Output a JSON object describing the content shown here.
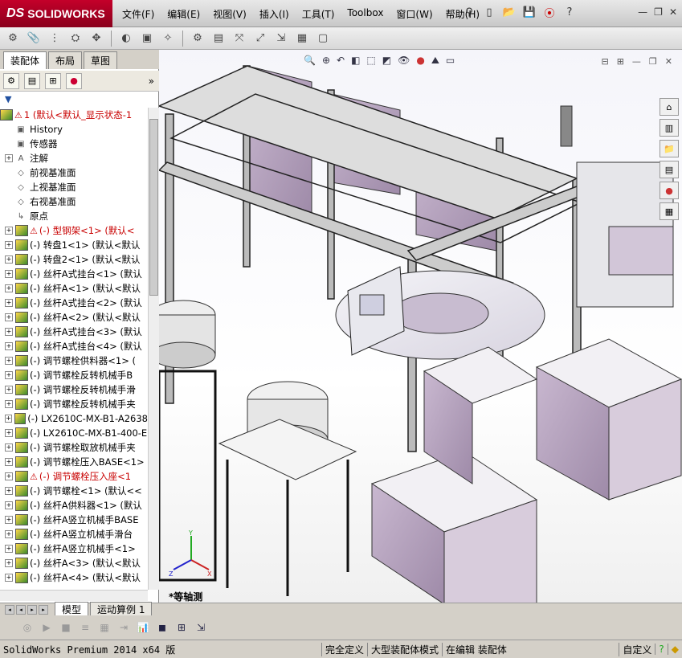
{
  "app": {
    "brand": "SOLIDWORKS",
    "brand_prefix": "DS"
  },
  "menu": [
    "文件(F)",
    "编辑(E)",
    "视图(V)",
    "插入(I)",
    "工具(T)",
    "Toolbox",
    "窗口(W)",
    "帮助(H)"
  ],
  "panel_tabs": [
    "装配体",
    "布局",
    "草图"
  ],
  "tree": {
    "root": "1 (默认<默认_显示状态-1",
    "items": [
      {
        "label": "History",
        "icon": "history-icon",
        "expand": false
      },
      {
        "label": "传感器",
        "icon": "sensor-icon",
        "expand": false
      },
      {
        "label": "注解",
        "icon": "annotation-icon",
        "expand": true
      },
      {
        "label": "前视基准面",
        "icon": "plane-icon",
        "expand": false
      },
      {
        "label": "上视基准面",
        "icon": "plane-icon",
        "expand": false
      },
      {
        "label": "右视基准面",
        "icon": "plane-icon",
        "expand": false
      },
      {
        "label": "原点",
        "icon": "origin-icon",
        "expand": false
      },
      {
        "label": "(-) 型钢架<1> (默认<",
        "icon": "part-icon",
        "expand": true,
        "warn": true,
        "red": true
      },
      {
        "label": "(-) 转盘1<1> (默认<默认",
        "icon": "part-icon",
        "expand": true
      },
      {
        "label": "(-) 转盘2<1> (默认<默认",
        "icon": "part-icon",
        "expand": true
      },
      {
        "label": "(-) 丝杆A式挂台<1> (默认",
        "icon": "part-icon",
        "expand": true
      },
      {
        "label": "(-) 丝杆A<1> (默认<默认",
        "icon": "part-icon",
        "expand": true
      },
      {
        "label": "(-) 丝杆A式挂台<2> (默认",
        "icon": "part-icon",
        "expand": true
      },
      {
        "label": "(-) 丝杆A<2> (默认<默认",
        "icon": "part-icon",
        "expand": true
      },
      {
        "label": "(-) 丝杆A式挂台<3> (默认",
        "icon": "part-icon",
        "expand": true
      },
      {
        "label": "(-) 丝杆A式挂台<4> (默认",
        "icon": "part-icon",
        "expand": true
      },
      {
        "label": "(-) 调节螺栓供料器<1> (",
        "icon": "part-icon",
        "expand": true
      },
      {
        "label": "(-) 调节螺栓反转机械手B",
        "icon": "part-icon",
        "expand": true
      },
      {
        "label": "(-) 调节螺栓反转机械手滑",
        "icon": "part-icon",
        "expand": true
      },
      {
        "label": "(-) 调节螺栓反转机械手夹",
        "icon": "part-icon",
        "expand": true
      },
      {
        "label": "(-) LX2610C-MX-B1-A2638",
        "icon": "part-icon",
        "expand": true
      },
      {
        "label": "(-) LX2610C-MX-B1-400-E",
        "icon": "part-icon",
        "expand": true
      },
      {
        "label": "(-) 调节螺栓取放机械手夹",
        "icon": "part-icon",
        "expand": true
      },
      {
        "label": "(-) 调节螺栓压入BASE<1>",
        "icon": "part-icon",
        "expand": true
      },
      {
        "label": "(-) 调节螺栓压入座<1",
        "icon": "part-icon",
        "expand": true,
        "warn": true,
        "red": true
      },
      {
        "label": "(-) 调节螺栓<1> (默认<<",
        "icon": "part-icon",
        "expand": true
      },
      {
        "label": "(-) 丝杆A供料器<1> (默认",
        "icon": "part-icon",
        "expand": true
      },
      {
        "label": "(-) 丝杆A竖立机械手BASE",
        "icon": "part-icon",
        "expand": true
      },
      {
        "label": "(-) 丝杆A竖立机械手滑台",
        "icon": "part-icon",
        "expand": true
      },
      {
        "label": "(-) 丝杆A竖立机械手<1>",
        "icon": "part-icon",
        "expand": true
      },
      {
        "label": "(-) 丝杆A<3> (默认<默认",
        "icon": "part-icon",
        "expand": true
      },
      {
        "label": "(-) 丝杆A<4> (默认<默认",
        "icon": "part-icon",
        "expand": true
      }
    ]
  },
  "bottom_tabs": [
    "模型",
    "运动算例 1"
  ],
  "view_label": "*等轴测",
  "status": {
    "app_version": "SolidWorks Premium 2014 x64 版",
    "seg1": "完全定义",
    "seg2": "大型装配体模式",
    "seg3": "在编辑 装配体",
    "seg4": "自定义"
  }
}
